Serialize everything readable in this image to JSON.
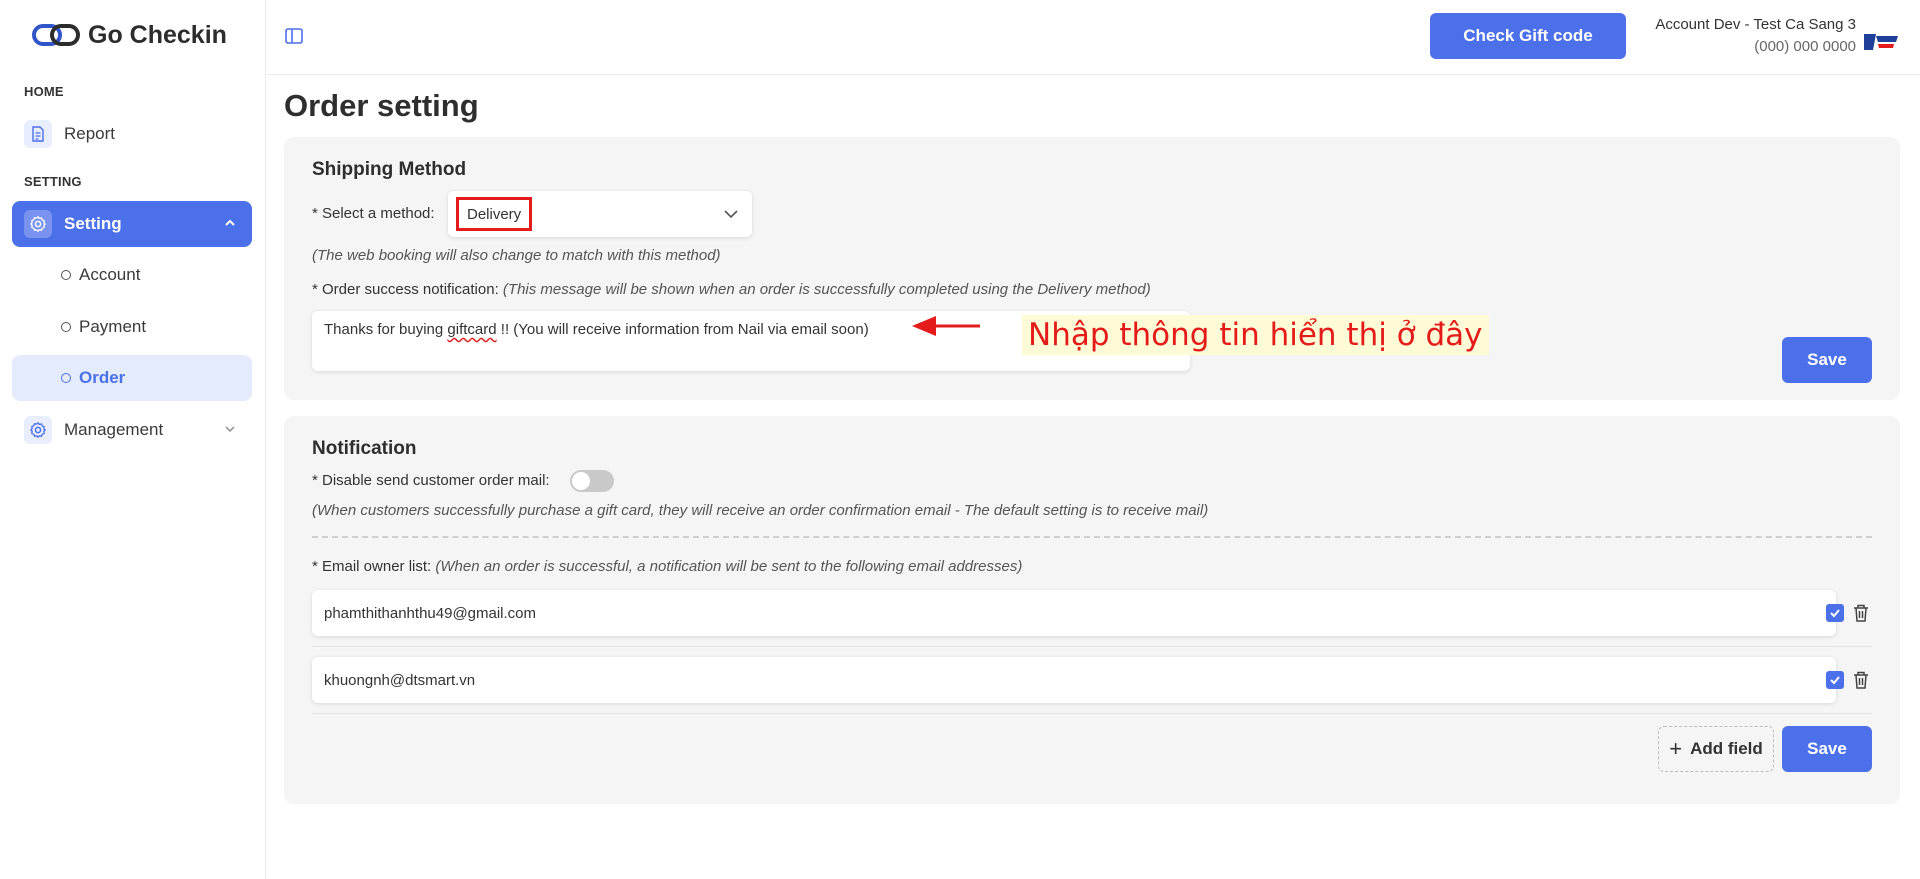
{
  "app": {
    "name": "Go Checkin"
  },
  "sidebar": {
    "sections": [
      {
        "label": "HOME"
      },
      {
        "label": "SETTING"
      }
    ],
    "items": {
      "report": "Report",
      "setting": "Setting",
      "account": "Account",
      "payment": "Payment",
      "order": "Order",
      "management": "Management"
    }
  },
  "header": {
    "check_gift_label": "Check Gift code",
    "account_name": "Account Dev - Test Ca Sang 3",
    "account_phone": "(000) 000 0000"
  },
  "page": {
    "title": "Order setting"
  },
  "shipping": {
    "title": "Shipping Method",
    "method_label": "* Select a method:",
    "method_value": "Delivery",
    "method_hint": "(The web booking will also change to match with this method)",
    "notif_label": "* Order success notification:",
    "notif_hint": "(This message will be shown when an order is successfully completed using the Delivery method)",
    "notif_text_before": "Thanks for buying ",
    "notif_text_misspelled": "giftcard",
    "notif_text_after": " !! (You will receive information from Nail via email soon)",
    "annotation": "Nhập thông tin hiển thị ở đây",
    "save_label": "Save"
  },
  "notification": {
    "title": "Notification",
    "disable_label": "* Disable send customer order mail:",
    "disable_on": false,
    "disable_hint": "(When customers successfully purchase a gift card, they will receive an order confirmation email - The default setting is to receive mail)",
    "email_label": "* Email owner list:",
    "email_hint": "(When an order is successful, a notification will be sent to the following email addresses)",
    "emails": [
      {
        "value": "phamthithanhthu49@gmail.com",
        "checked": true
      },
      {
        "value": "khuongnh@dtsmart.vn",
        "checked": true
      }
    ],
    "add_field_label": "Add field",
    "save_label": "Save"
  },
  "colors": {
    "accent": "#4c6fea",
    "annotation_red": "#e31b1b",
    "annotation_bg": "#fffbd6"
  }
}
